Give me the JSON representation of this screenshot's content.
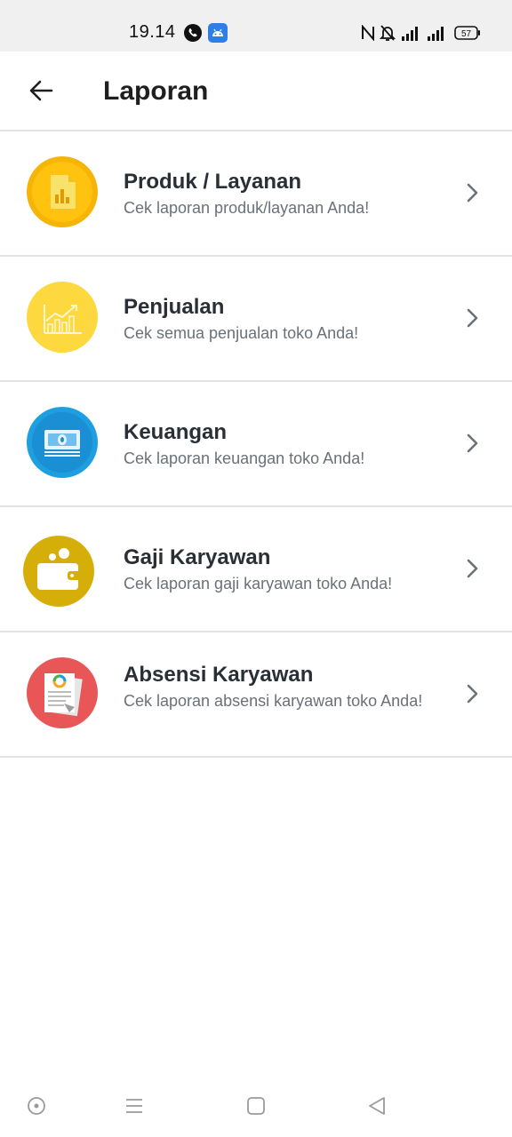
{
  "status_bar": {
    "time": "19.14",
    "battery": "57",
    "icons": [
      "whatsapp-icon",
      "android-icon",
      "nfc-icon",
      "bell-off-icon",
      "signal-icon",
      "signal-icon",
      "battery-icon"
    ]
  },
  "header": {
    "title": "Laporan",
    "back_icon": "arrow-left-icon"
  },
  "menu": [
    {
      "title": "Produk / Layanan",
      "subtitle": "Cek laporan produk/layanan Anda!",
      "icon": "product-report-icon",
      "color": "#F5B406"
    },
    {
      "title": "Penjualan",
      "subtitle": "Cek semua penjualan toko Anda!",
      "icon": "sales-chart-icon",
      "color": "#FDD83F"
    },
    {
      "title": "Keuangan",
      "subtitle": "Cek laporan keuangan toko Anda!",
      "icon": "money-icon",
      "color": "#1E9FE0"
    },
    {
      "title": "Gaji Karyawan",
      "subtitle": "Cek laporan gaji karyawan toko Anda!",
      "icon": "wallet-icon",
      "color": "#D6AE0A"
    },
    {
      "title": "Absensi Karyawan",
      "subtitle": "Cek laporan absensi karyawan toko Anda!",
      "icon": "attendance-report-icon",
      "color": "#E95658"
    }
  ],
  "nav_bar": {
    "buttons": [
      "assistant-icon",
      "menu-icon",
      "home-icon",
      "back-icon"
    ]
  }
}
